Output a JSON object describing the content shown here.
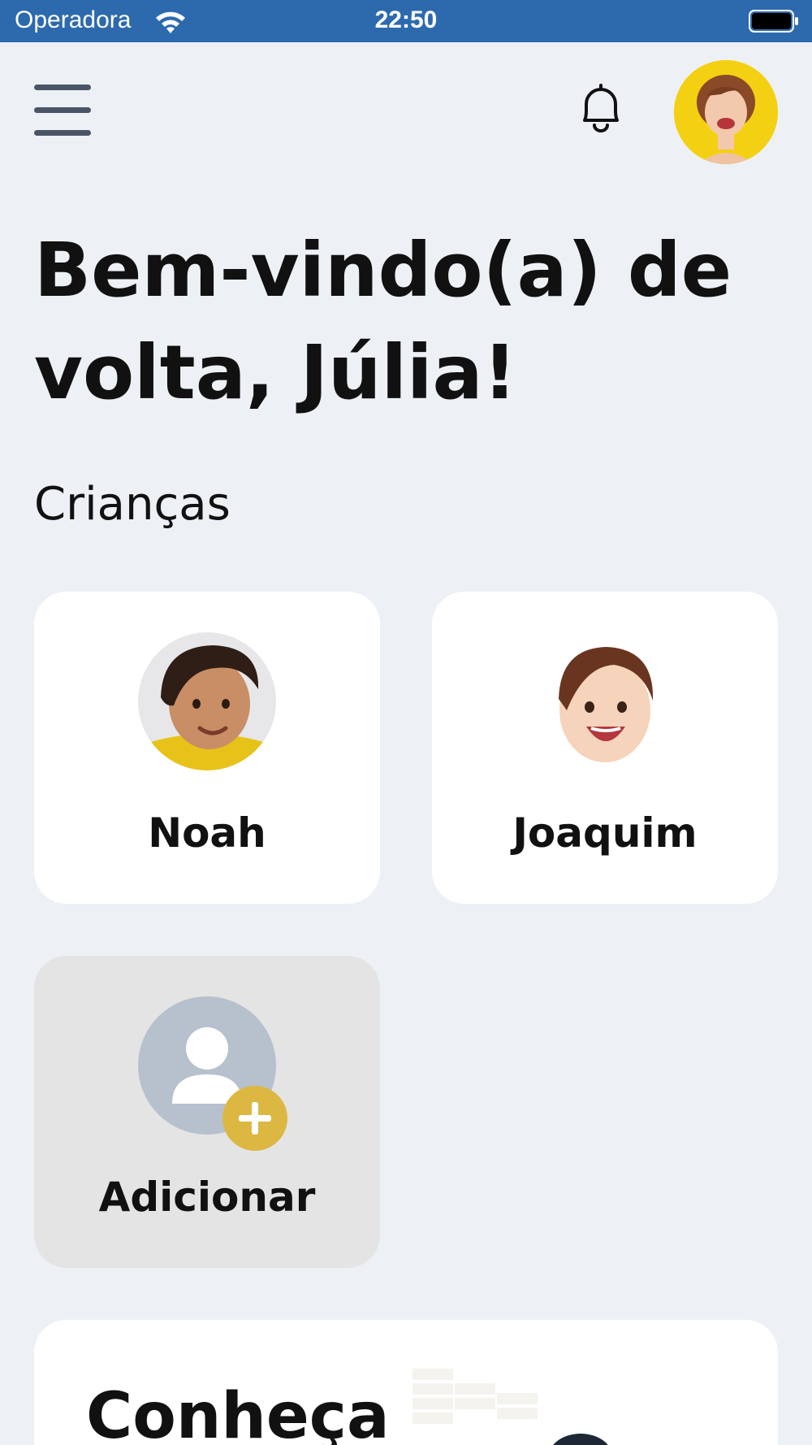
{
  "status_bar": {
    "carrier": "Operadora",
    "time": "22:50"
  },
  "header": {
    "menu_icon": "hamburger-menu-icon",
    "bell_icon": "bell-icon",
    "avatar_icon": "user-avatar"
  },
  "welcome": {
    "line1": "Bem-vindo(a) de",
    "line2": "volta, Júlia!"
  },
  "children_section": {
    "title": "Crianças",
    "children": [
      {
        "name": "Noah"
      },
      {
        "name": "Joaquim"
      }
    ],
    "add_label": "Adicionar"
  },
  "promo": {
    "title": "Conheça"
  },
  "colors": {
    "status_bar": "#2d6aad",
    "background": "#edf1f6",
    "accent": "#dcb843",
    "placeholder": "#b7c0cd"
  }
}
